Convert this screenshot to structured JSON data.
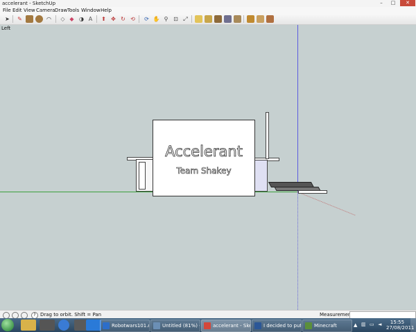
{
  "window": {
    "title": "accelerant - SketchUp",
    "buttons": [
      "–",
      "□",
      "✕"
    ]
  },
  "menu": [
    "File",
    "Edit",
    "View",
    "Camera",
    "Draw",
    "Tools",
    "Window",
    "Help"
  ],
  "toolbar": {
    "icons": [
      "select-arrow-icon",
      "pencil-icon",
      "rectangle-icon",
      "circle-icon",
      "arc-icon",
      "eraser-icon",
      "paint-bucket-icon",
      "tape-measure-icon",
      "text-icon",
      "push-pull-icon",
      "move-icon",
      "rotate-icon",
      "offset-icon",
      "follow-me-icon",
      "orbit-icon",
      "pan-icon",
      "zoom-icon",
      "zoom-extents-icon",
      "zoom-window-icon",
      "previous-view-icon",
      "iso-view-icon",
      "top-view-icon",
      "front-view-icon",
      "right-view-icon",
      "back-view-icon",
      "left-view-icon",
      "components-icon",
      "materials-icon",
      "warehouse-icon"
    ]
  },
  "viewport": {
    "scene_label": "Left",
    "billboard": {
      "title": "Accelerant",
      "subtitle": "Team Shakey"
    },
    "colors": {
      "background": "#c6d0d0",
      "red_axis": "#c07070",
      "green_axis": "#3aa03a",
      "blue_axis": "#5a5ae0"
    }
  },
  "status": {
    "hint": "Drag to orbit.  Shift = Pan",
    "measurements_label": "Measurements",
    "measurements_value": ""
  },
  "taskbar": {
    "tasks": [
      {
        "label": "Robotwars101.o...",
        "color": "#2d6ec9"
      },
      {
        "label": "Untitled (81%) - ...",
        "color": "#6b8fb5"
      },
      {
        "label": "accelerant - Sket...",
        "color": "#d4473a",
        "active": true
      },
      {
        "label": "I decided to put ...",
        "color": "#2b5797"
      },
      {
        "label": "Minecraft",
        "color": "#5b8f3b"
      }
    ],
    "clock_time": "15:55",
    "clock_date": "27/08/2011"
  }
}
